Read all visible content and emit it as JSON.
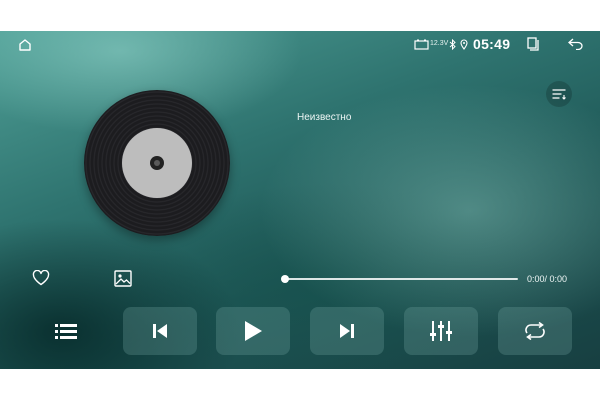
{
  "status_bar": {
    "voltage": "12.3V",
    "time": "05:49"
  },
  "player": {
    "track_title": "Неизвестно",
    "elapsed": "0:00",
    "duration": "0:00",
    "time_display": "0:00/ 0:00",
    "progress": 0
  },
  "icons": {
    "home": "home-icon",
    "battery": "battery-icon",
    "bluetooth": "bluetooth-icon",
    "location": "location-pin-icon",
    "multitask": "multitask-icon",
    "back": "back-icon",
    "sort": "sort-icon",
    "favorite": "heart-icon",
    "image": "image-icon",
    "playlist": "playlist-icon",
    "previous": "previous-track-icon",
    "play": "play-icon",
    "next": "next-track-icon",
    "equalizer": "equalizer-icon",
    "repeat": "repeat-icon"
  },
  "colors": {
    "background_dark": "#173f41",
    "background_light": "#4f9f96",
    "foreground": "#ffffff",
    "disc": "#1c1c1f",
    "disc_label": "#bdbdbd"
  }
}
